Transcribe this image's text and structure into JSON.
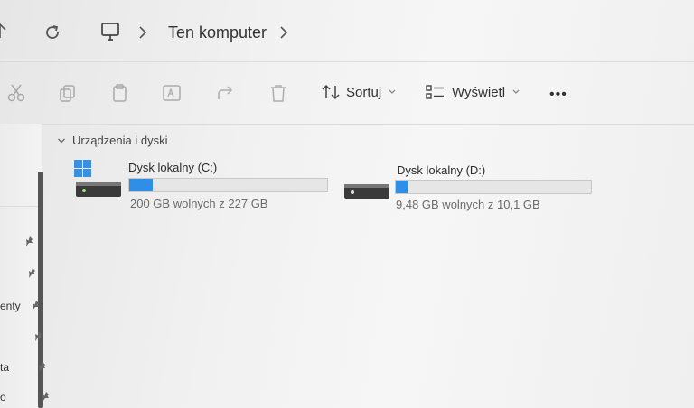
{
  "address": {
    "current": "Ten komputer"
  },
  "toolbar": {
    "sort_label": "Sortuj",
    "view_label": "Wyświetl",
    "more_label": "•••"
  },
  "sidebar": {
    "items": [
      {
        "label": ""
      },
      {
        "label": ""
      },
      {
        "label": "enty"
      },
      {
        "label": ""
      },
      {
        "label": "ta"
      },
      {
        "label": "o"
      }
    ]
  },
  "section": {
    "title": "Urządzenia i dyski"
  },
  "drives": [
    {
      "name": "Dysk lokalny (C:)",
      "info": "200 GB wolnych z 227 GB",
      "used_fraction": 0.12
    },
    {
      "name": "Dysk lokalny (D:)",
      "info": "9,48 GB wolnych z 10,1 GB",
      "used_fraction": 0.06
    }
  ],
  "colors": {
    "accent": "#2f8ee8",
    "windows_logo": "#3a8fe0"
  }
}
